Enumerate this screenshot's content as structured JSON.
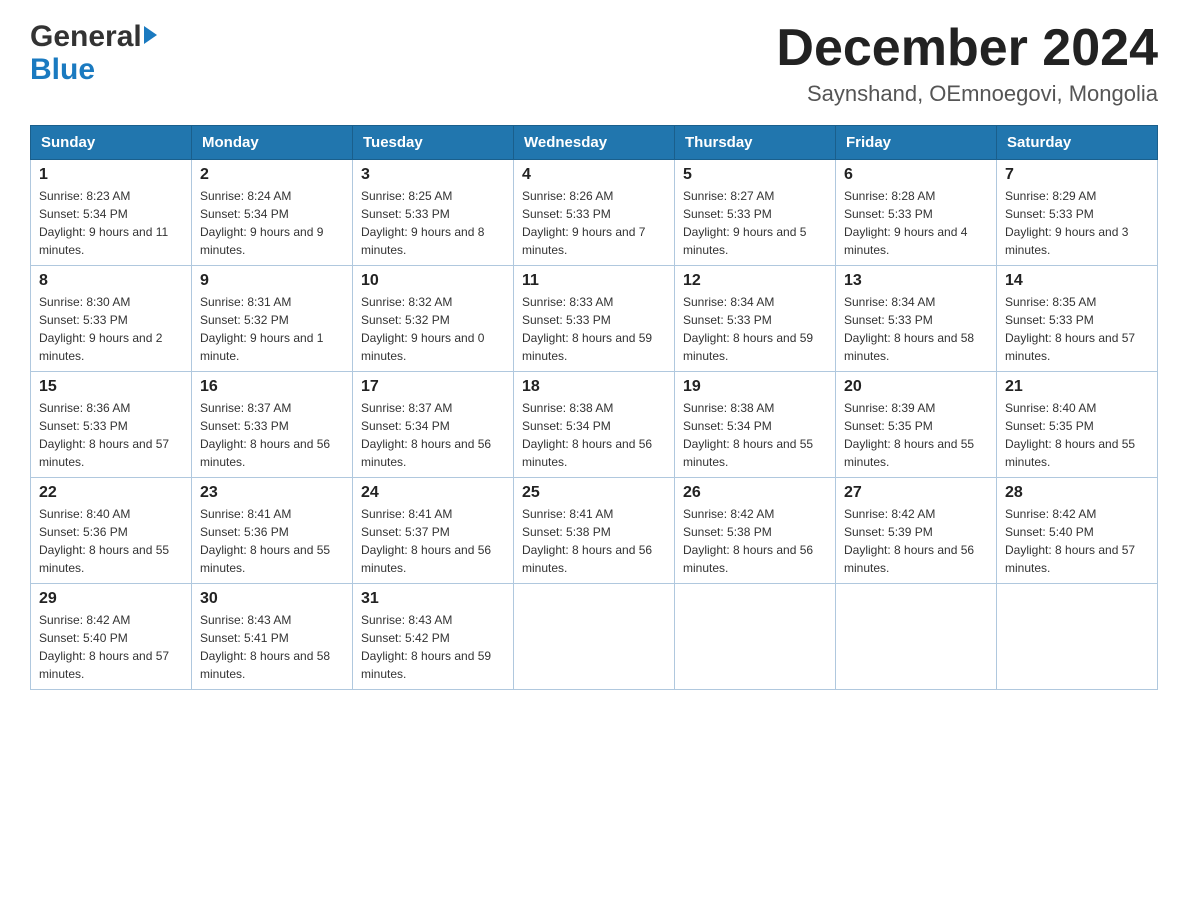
{
  "header": {
    "logo_general": "General",
    "logo_blue": "Blue",
    "title": "December 2024",
    "subtitle": "Saynshand, OEmnoegovi, Mongolia"
  },
  "days_of_week": [
    "Sunday",
    "Monday",
    "Tuesday",
    "Wednesday",
    "Thursday",
    "Friday",
    "Saturday"
  ],
  "weeks": [
    [
      {
        "day": "1",
        "sunrise": "8:23 AM",
        "sunset": "5:34 PM",
        "daylight": "9 hours and 11 minutes."
      },
      {
        "day": "2",
        "sunrise": "8:24 AM",
        "sunset": "5:34 PM",
        "daylight": "9 hours and 9 minutes."
      },
      {
        "day": "3",
        "sunrise": "8:25 AM",
        "sunset": "5:33 PM",
        "daylight": "9 hours and 8 minutes."
      },
      {
        "day": "4",
        "sunrise": "8:26 AM",
        "sunset": "5:33 PM",
        "daylight": "9 hours and 7 minutes."
      },
      {
        "day": "5",
        "sunrise": "8:27 AM",
        "sunset": "5:33 PM",
        "daylight": "9 hours and 5 minutes."
      },
      {
        "day": "6",
        "sunrise": "8:28 AM",
        "sunset": "5:33 PM",
        "daylight": "9 hours and 4 minutes."
      },
      {
        "day": "7",
        "sunrise": "8:29 AM",
        "sunset": "5:33 PM",
        "daylight": "9 hours and 3 minutes."
      }
    ],
    [
      {
        "day": "8",
        "sunrise": "8:30 AM",
        "sunset": "5:33 PM",
        "daylight": "9 hours and 2 minutes."
      },
      {
        "day": "9",
        "sunrise": "8:31 AM",
        "sunset": "5:32 PM",
        "daylight": "9 hours and 1 minute."
      },
      {
        "day": "10",
        "sunrise": "8:32 AM",
        "sunset": "5:32 PM",
        "daylight": "9 hours and 0 minutes."
      },
      {
        "day": "11",
        "sunrise": "8:33 AM",
        "sunset": "5:33 PM",
        "daylight": "8 hours and 59 minutes."
      },
      {
        "day": "12",
        "sunrise": "8:34 AM",
        "sunset": "5:33 PM",
        "daylight": "8 hours and 59 minutes."
      },
      {
        "day": "13",
        "sunrise": "8:34 AM",
        "sunset": "5:33 PM",
        "daylight": "8 hours and 58 minutes."
      },
      {
        "day": "14",
        "sunrise": "8:35 AM",
        "sunset": "5:33 PM",
        "daylight": "8 hours and 57 minutes."
      }
    ],
    [
      {
        "day": "15",
        "sunrise": "8:36 AM",
        "sunset": "5:33 PM",
        "daylight": "8 hours and 57 minutes."
      },
      {
        "day": "16",
        "sunrise": "8:37 AM",
        "sunset": "5:33 PM",
        "daylight": "8 hours and 56 minutes."
      },
      {
        "day": "17",
        "sunrise": "8:37 AM",
        "sunset": "5:34 PM",
        "daylight": "8 hours and 56 minutes."
      },
      {
        "day": "18",
        "sunrise": "8:38 AM",
        "sunset": "5:34 PM",
        "daylight": "8 hours and 56 minutes."
      },
      {
        "day": "19",
        "sunrise": "8:38 AM",
        "sunset": "5:34 PM",
        "daylight": "8 hours and 55 minutes."
      },
      {
        "day": "20",
        "sunrise": "8:39 AM",
        "sunset": "5:35 PM",
        "daylight": "8 hours and 55 minutes."
      },
      {
        "day": "21",
        "sunrise": "8:40 AM",
        "sunset": "5:35 PM",
        "daylight": "8 hours and 55 minutes."
      }
    ],
    [
      {
        "day": "22",
        "sunrise": "8:40 AM",
        "sunset": "5:36 PM",
        "daylight": "8 hours and 55 minutes."
      },
      {
        "day": "23",
        "sunrise": "8:41 AM",
        "sunset": "5:36 PM",
        "daylight": "8 hours and 55 minutes."
      },
      {
        "day": "24",
        "sunrise": "8:41 AM",
        "sunset": "5:37 PM",
        "daylight": "8 hours and 56 minutes."
      },
      {
        "day": "25",
        "sunrise": "8:41 AM",
        "sunset": "5:38 PM",
        "daylight": "8 hours and 56 minutes."
      },
      {
        "day": "26",
        "sunrise": "8:42 AM",
        "sunset": "5:38 PM",
        "daylight": "8 hours and 56 minutes."
      },
      {
        "day": "27",
        "sunrise": "8:42 AM",
        "sunset": "5:39 PM",
        "daylight": "8 hours and 56 minutes."
      },
      {
        "day": "28",
        "sunrise": "8:42 AM",
        "sunset": "5:40 PM",
        "daylight": "8 hours and 57 minutes."
      }
    ],
    [
      {
        "day": "29",
        "sunrise": "8:42 AM",
        "sunset": "5:40 PM",
        "daylight": "8 hours and 57 minutes."
      },
      {
        "day": "30",
        "sunrise": "8:43 AM",
        "sunset": "5:41 PM",
        "daylight": "8 hours and 58 minutes."
      },
      {
        "day": "31",
        "sunrise": "8:43 AM",
        "sunset": "5:42 PM",
        "daylight": "8 hours and 59 minutes."
      },
      null,
      null,
      null,
      null
    ]
  ]
}
